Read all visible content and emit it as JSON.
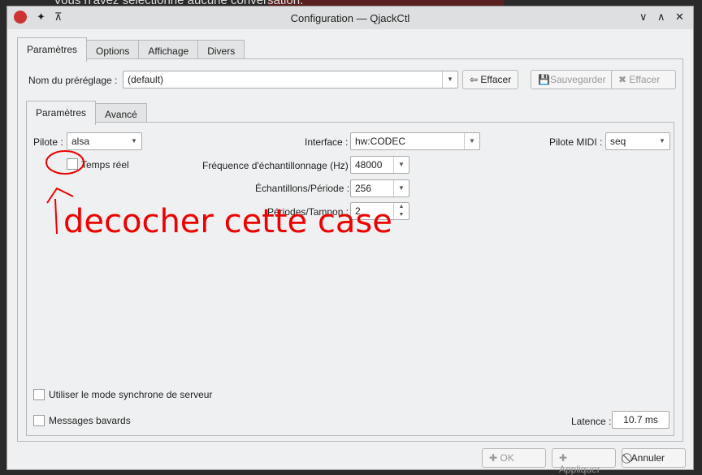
{
  "background": {
    "text": "Vous n'avez sélectionné aucune conversation."
  },
  "window": {
    "title": "Configuration — QjackCtl"
  },
  "tabs": [
    "Paramètres",
    "Options",
    "Affichage",
    "Divers"
  ],
  "preset": {
    "label": "Nom du préréglage :",
    "value": "(default)",
    "clear_label": "Effacer",
    "save_label": "Sauvegarder",
    "delete_label": "Effacer"
  },
  "subtabs": [
    "Paramètres",
    "Avancé"
  ],
  "fields": {
    "driver_label": "Pilote :",
    "driver": "alsa",
    "interface_label": "Interface :",
    "interface": "hw:CODEC",
    "midi_label": "Pilote MIDI :",
    "midi": "seq",
    "realtime_label": "Temps réel",
    "rate_label": "Fréquence d'échantillonnage (Hz) :",
    "rate": "48000",
    "frames_label": "Échantillons/Période :",
    "frames": "256",
    "periods_label": "Périodes/Tampon :",
    "periods": "2",
    "sync_label": "Utiliser le mode synchrone de serveur",
    "verbose_label": "Messages bavards",
    "latency_label": "Latence :",
    "latency": "10.7 ms"
  },
  "annotation": "decocher cette case",
  "buttons": {
    "ok": "OK",
    "apply": "Appliquer",
    "cancel": "Annuler"
  }
}
